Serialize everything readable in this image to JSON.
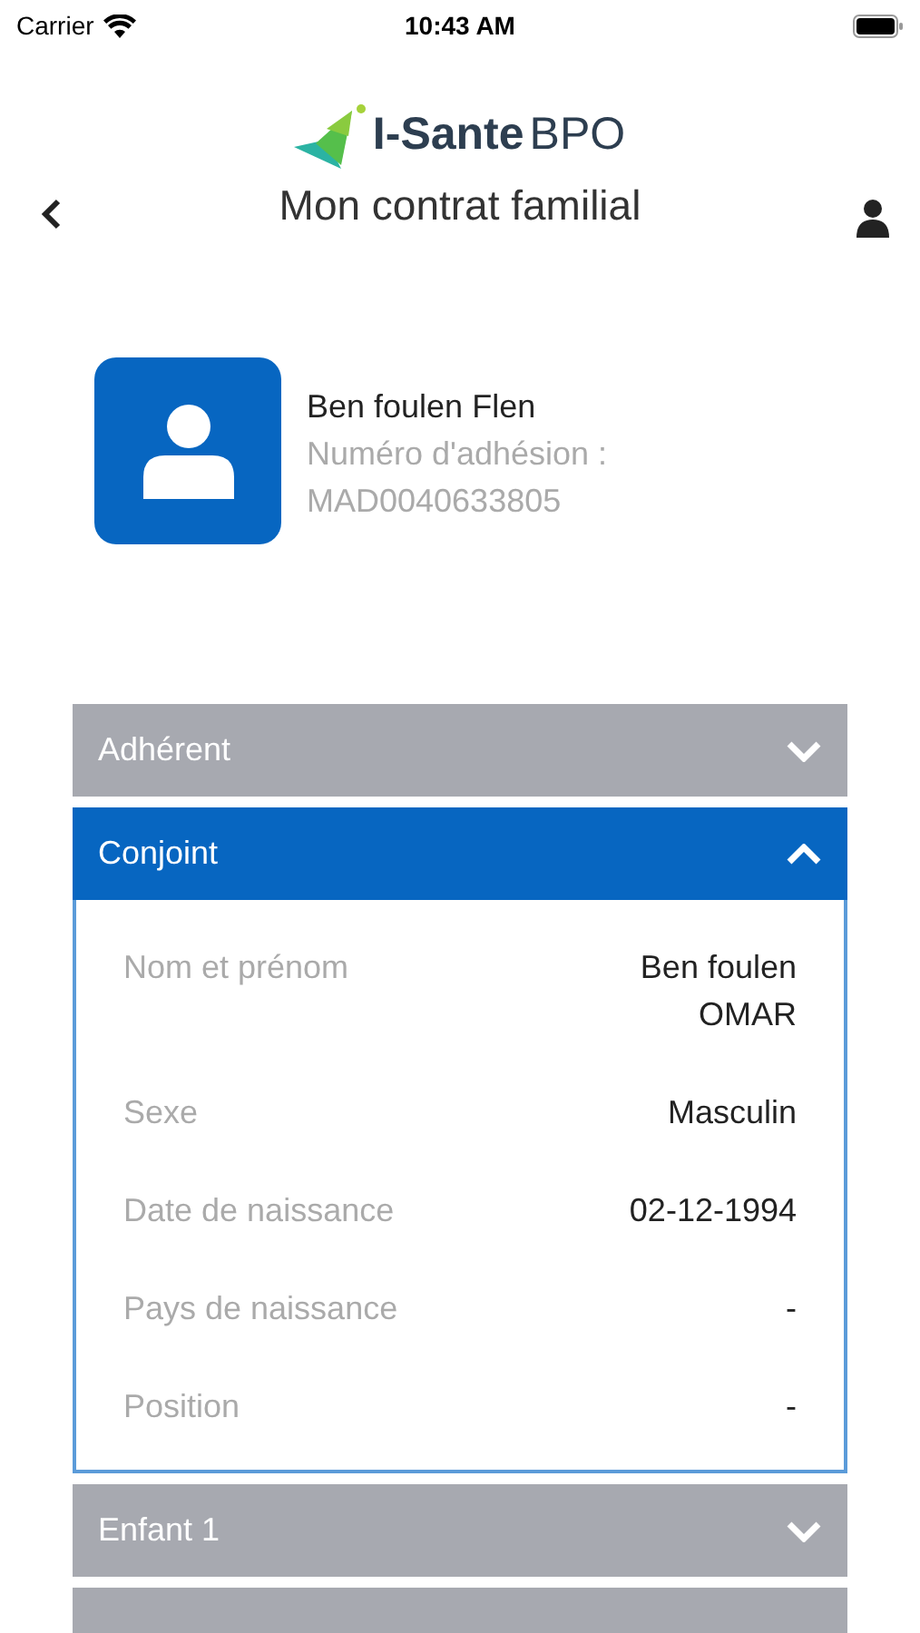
{
  "status_bar": {
    "carrier": "Carrier",
    "time": "10:43 AM"
  },
  "header": {
    "brand": "I-Sante",
    "brand_suffix": "BPO",
    "title": "Mon contrat familial"
  },
  "member": {
    "name": "Ben foulen Flen",
    "number_label": "Numéro d'adhésion :",
    "number": "MAD0040633805"
  },
  "sections": [
    {
      "title": "Adhérent",
      "expanded": false
    },
    {
      "title": "Conjoint",
      "expanded": true,
      "fields": [
        {
          "label": "Nom et prénom",
          "value": "Ben foulen OMAR"
        },
        {
          "label": "Sexe",
          "value": "Masculin"
        },
        {
          "label": "Date de naissance",
          "value": "02-12-1994"
        },
        {
          "label": "Pays de naissance",
          "value": "-"
        },
        {
          "label": "Position",
          "value": "-"
        }
      ]
    },
    {
      "title": "Enfant 1",
      "expanded": false
    },
    {
      "expanded": false
    }
  ]
}
